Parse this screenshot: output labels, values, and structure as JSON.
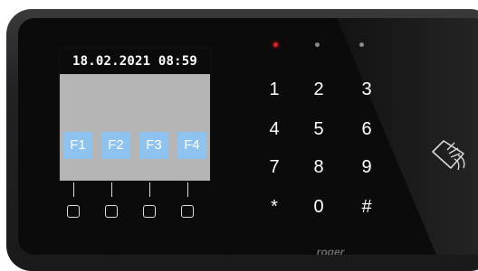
{
  "screen": {
    "datetime": "18.02.2021 08:59",
    "function_keys": [
      "F1",
      "F2",
      "F3",
      "F4"
    ]
  },
  "indicators": [
    {
      "name": "status-led-red",
      "color": "#e02020"
    },
    {
      "name": "status-led-gray-1",
      "color": "#8a8a8a"
    },
    {
      "name": "status-led-gray-2",
      "color": "#8a8a8a"
    }
  ],
  "keypad": {
    "keys": [
      "1",
      "2",
      "3",
      "4",
      "5",
      "6",
      "7",
      "8",
      "9",
      "*",
      "0",
      "#"
    ]
  },
  "brand": {
    "label": "roger"
  },
  "colors": {
    "screen_bg": "#b5b5b5",
    "fkey_bg": "#8fc3ef",
    "panel_bg": "#0b0b0c"
  },
  "icons": {
    "rfid": "contactless-card-icon"
  }
}
